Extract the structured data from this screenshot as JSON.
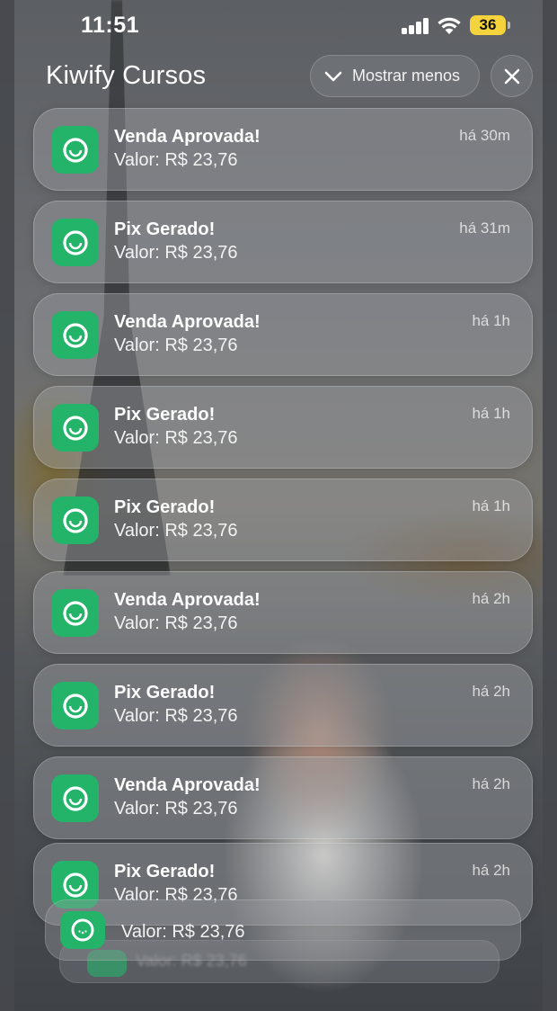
{
  "status_bar": {
    "time": "11:51",
    "battery": "36"
  },
  "header": {
    "app_name": "Kiwify Cursos",
    "collapse_label": "Mostrar menos"
  },
  "notifications": [
    {
      "title": "Venda Aprovada!",
      "body": "Valor: R$ 23,76",
      "ago": "há 30m"
    },
    {
      "title": "Pix Gerado!",
      "body": "Valor: R$ 23,76",
      "ago": "há 31m"
    },
    {
      "title": "Venda Aprovada!",
      "body": "Valor: R$ 23,76",
      "ago": "há 1h"
    },
    {
      "title": "Pix Gerado!",
      "body": "Valor: R$ 23,76",
      "ago": "há 1h"
    },
    {
      "title": "Pix Gerado!",
      "body": "Valor: R$ 23,76",
      "ago": "há 1h"
    },
    {
      "title": "Venda Aprovada!",
      "body": "Valor: R$ 23,76",
      "ago": "há 2h"
    },
    {
      "title": "Pix Gerado!",
      "body": "Valor: R$ 23,76",
      "ago": "há 2h"
    },
    {
      "title": "Venda Aprovada!",
      "body": "Valor: R$ 23,76",
      "ago": "há 2h"
    },
    {
      "title": "Pix Gerado!",
      "body": "Valor: R$ 23,76",
      "ago": "há 2h"
    }
  ],
  "stacked": {
    "body": "Valor: R$ 23,76"
  },
  "colors": {
    "app_icon": "#23b46a",
    "battery": "#f5d33c"
  }
}
